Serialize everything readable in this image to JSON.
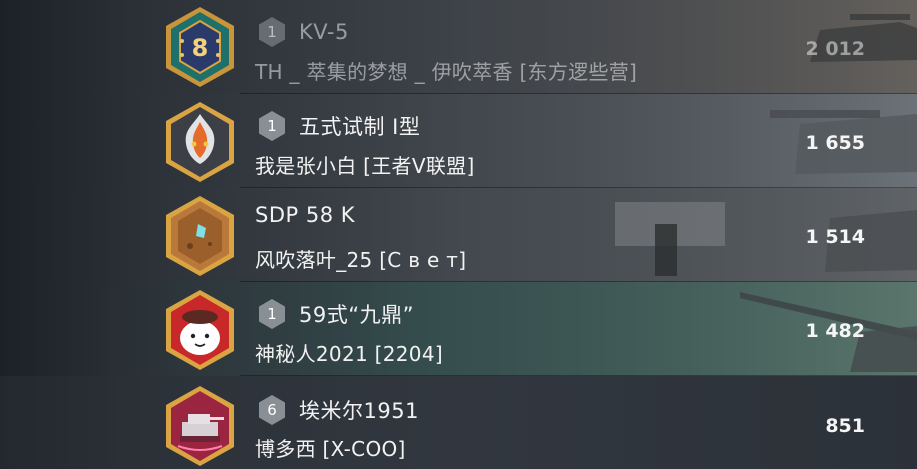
{
  "leaderboard": {
    "rows": [
      {
        "tier": "1",
        "vehicle": "KV-5",
        "player": "TH _ 萃集的梦想 _ 伊吹萃香 [东方逻些营]",
        "score": "2 012",
        "badge_icon": "rank-8-medal-icon"
      },
      {
        "tier": "1",
        "vehicle": "五式试制 I型",
        "player": "我是张小白 [王者V联盟]",
        "score": "1 655",
        "badge_icon": "flame-dragon-emblem-icon"
      },
      {
        "tier": "",
        "vehicle": "SDP 58 K",
        "player": "风吹落叶_25 [С в е т]",
        "score": "1 514",
        "badge_icon": "crystal-rock-emblem-icon"
      },
      {
        "tier": "1",
        "vehicle": "59式“九鼎”",
        "player": "神秘人2021 [2204]",
        "score": "1 482",
        "badge_icon": "cartoon-face-avatar-icon"
      },
      {
        "tier": "6",
        "vehicle": "埃米尔1951",
        "player": "博多西 [X-COO]",
        "score": "851",
        "badge_icon": "pink-tank-emblem-icon"
      }
    ]
  },
  "colors": {
    "badge_border": "#d9a441",
    "tier_badge": "#8a8f96",
    "text": "#f2f2f2"
  }
}
